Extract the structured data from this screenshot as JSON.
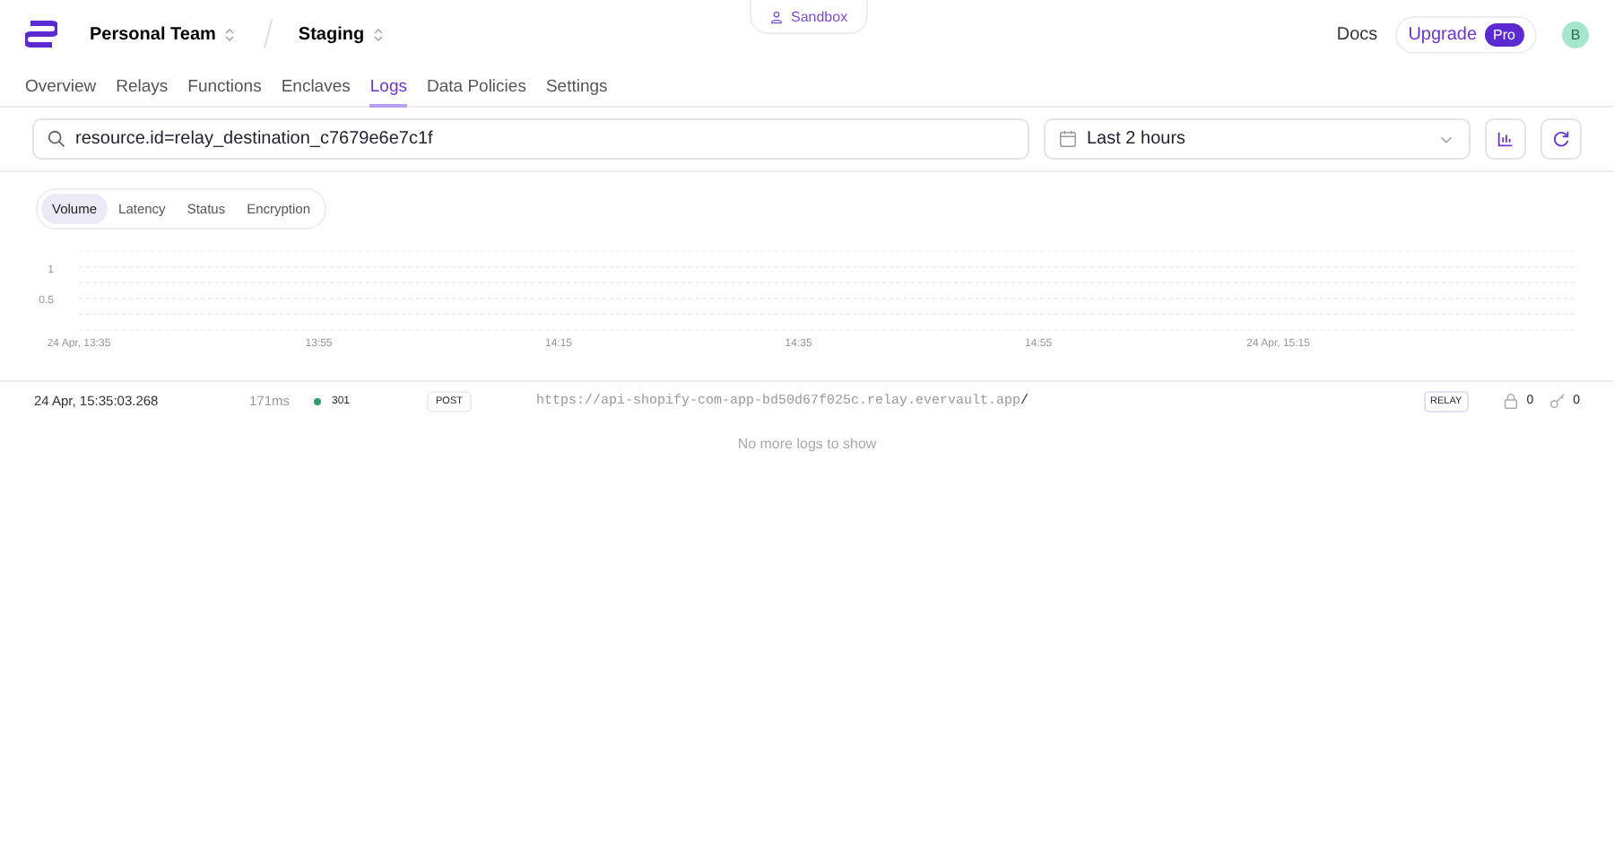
{
  "header": {
    "team": "Personal Team",
    "environment": "Staging",
    "sandbox": "Sandbox",
    "docs": "Docs",
    "upgrade": "Upgrade",
    "plan_badge": "Pro",
    "avatar": "B"
  },
  "nav_tabs": [
    {
      "label": "Overview",
      "selected": false
    },
    {
      "label": "Relays",
      "selected": false
    },
    {
      "label": "Functions",
      "selected": false
    },
    {
      "label": "Enclaves",
      "selected": false
    },
    {
      "label": "Logs",
      "selected": true
    },
    {
      "label": "Data Policies",
      "selected": false
    },
    {
      "label": "Settings",
      "selected": false
    }
  ],
  "search": {
    "value": "resource.id=relay_destination_c7679e6e7c1f"
  },
  "time_range": {
    "value": "Last 2 hours"
  },
  "chart_tabs": [
    {
      "label": "Volume",
      "selected": true
    },
    {
      "label": "Latency",
      "selected": false
    },
    {
      "label": "Status",
      "selected": false
    },
    {
      "label": "Encryption",
      "selected": false
    }
  ],
  "chart_data": {
    "type": "bar",
    "categories": [
      "24 Apr, 13:35",
      null,
      null,
      null,
      "13:55",
      null,
      null,
      null,
      "14:15",
      null,
      null,
      null,
      "14:35",
      null,
      null,
      null,
      "14:55",
      null,
      null,
      null,
      "24 Apr, 15:15",
      null,
      null,
      null,
      null
    ],
    "yticks": [
      {
        "value": 0.5,
        "label": "0.5"
      },
      {
        "value": 1,
        "label": "1"
      }
    ],
    "ylim": [
      0,
      1.3
    ]
  },
  "logs": [
    {
      "time": "24 Apr, 15:35:03.268",
      "duration": "171ms",
      "status": "301",
      "color": "#2f9e6f",
      "method": "POST",
      "url_host": "https://api-shopify-com-app-bd50d67f025c.relay.evervault.app",
      "url_path": "/",
      "type": "RELAY",
      "encrypted": "0",
      "decrypted": "0"
    }
  ],
  "empty_message": "No more logs to show"
}
